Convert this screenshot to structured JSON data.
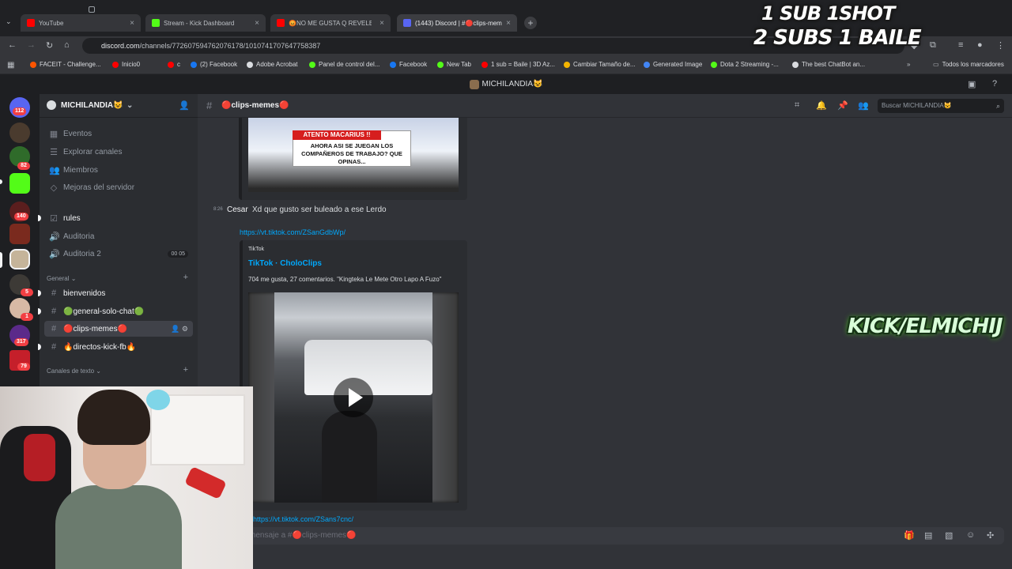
{
  "browser": {
    "tabs": [
      {
        "label": "YouTube",
        "color": "#ff0000"
      },
      {
        "label": "Stream - Kick Dashboard",
        "color": "#53fc18"
      },
      {
        "label": "😡NO ME GUSTA Q REVELES C...",
        "color": "#ff0000"
      },
      {
        "label": "(1443) Discord | #🔴clips-memes",
        "color": "#5865f2"
      }
    ],
    "url_host": "discord.com",
    "url_path": "/channels/772607594762076178/1010741707647758387",
    "bookmarks": [
      {
        "label": "FACEIT - Challenge...",
        "color": "#ff5500"
      },
      {
        "label": "Inicio0",
        "color": "#ff0000"
      },
      {
        "label": "c",
        "color": "#ff0000"
      },
      {
        "label": "(2) Facebook",
        "color": "#1877f2"
      },
      {
        "label": "Adobe Acrobat",
        "color": "#dadce0"
      },
      {
        "label": "Panel de control del...",
        "color": "#53fc18"
      },
      {
        "label": "Facebook",
        "color": "#1877f2"
      },
      {
        "label": "New Tab",
        "color": "#53fc18"
      },
      {
        "label": "1 sub = Baile | 3D Az...",
        "color": "#ff0000"
      },
      {
        "label": "Cambiar Tamaño de...",
        "color": "#f4b400"
      },
      {
        "label": "Generated Image",
        "color": "#4285f4"
      },
      {
        "label": "Dota 2 Streaming -...",
        "color": "#53fc18"
      },
      {
        "label": "The best ChatBot an...",
        "color": "#dadce0"
      }
    ],
    "all_bookmarks": "Todos los marcadores"
  },
  "overlay": {
    "line1": "1 SUB  1SHOT",
    "line2": "2 SUBS 1 BAILE",
    "kick": "KICK/ELMICHIJ"
  },
  "discord": {
    "window_title": "MICHILANDIA😺",
    "server_name": "MICHILANDIA😺",
    "rail_badges": [
      "112",
      "82",
      "140",
      "5",
      "1",
      "317",
      "79"
    ],
    "menu": [
      {
        "label": "Eventos",
        "icon": "calendar-icon"
      },
      {
        "label": "Explorar canales",
        "icon": "compass-icon"
      },
      {
        "label": "Miembros",
        "icon": "members-icon"
      },
      {
        "label": "Mejoras del servidor",
        "icon": "boost-icon"
      }
    ],
    "channels_top": [
      {
        "label": "rules"
      },
      {
        "label": "Auditoria"
      },
      {
        "label": "Auditoria 2",
        "count_a": "00",
        "count_b": "05"
      }
    ],
    "category_general": "General",
    "channels_general": [
      {
        "label": "bienvenidos"
      },
      {
        "label": "🟢general-solo-chat🟢"
      },
      {
        "label": "🔴clips-memes🔴"
      },
      {
        "label": "🔥directos-kick-fb🔥"
      }
    ],
    "category_text": "Canales de texto",
    "channel_header": "🔴clips-memes🔴",
    "search_placeholder": "Buscar MICHILANDIA😺",
    "thumb_red": "ATENTO MACARIUS !!",
    "thumb_text": "AHORA ASI SE JUEGAN LOS COMPAÑEROS DE TRABAJO? QUE OPINAS...",
    "message": {
      "time": "8:26",
      "author": "Cesar",
      "text": "Xd que gusto ser buleado a ese Lerdo",
      "link": "https://vt.tiktok.com/ZSanGdbWp/"
    },
    "embed": {
      "provider": "TikTok",
      "title": "TikTok · CholoClips",
      "description": "704 me gusta, 27 comentarios. \"Kingteka Le Mete Otro Lapo A Fuzo\""
    },
    "link2": "https://vt.tiktok.com/ZSans7cnc/",
    "composer_placeholder": "mensaje a #🔴clips-memes🔴"
  }
}
